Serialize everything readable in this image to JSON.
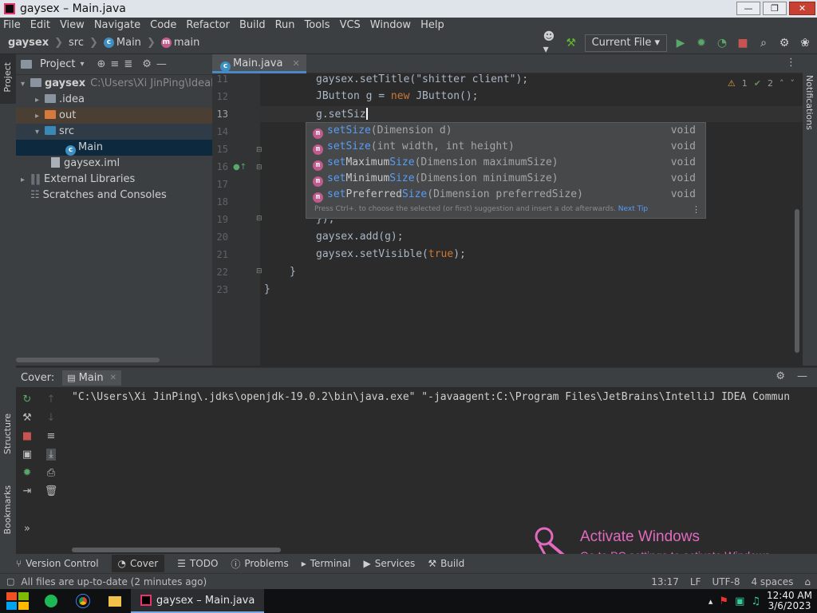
{
  "window": {
    "title": "gaysex – Main.java"
  },
  "menu": [
    "File",
    "Edit",
    "View",
    "Navigate",
    "Code",
    "Refactor",
    "Build",
    "Run",
    "Tools",
    "VCS",
    "Window",
    "Help"
  ],
  "breadcrumb": {
    "project": "gaysex",
    "folder": "src",
    "class": "Main",
    "method": "main"
  },
  "toolbar": {
    "run_config": "Current File"
  },
  "project_panel": {
    "title": "Project",
    "tree": [
      {
        "label": "gaysex",
        "hint": "C:\\Users\\Xi JinPing\\IdeaP"
      },
      {
        "label": ".idea"
      },
      {
        "label": "out"
      },
      {
        "label": "src"
      },
      {
        "label": "Main"
      },
      {
        "label": "gaysex.iml"
      },
      {
        "label": "External Libraries"
      },
      {
        "label": "Scratches and Consoles"
      }
    ]
  },
  "editor": {
    "tab": "Main.java",
    "inspection": {
      "warnings": "1",
      "weak": "2"
    },
    "lines": [
      "11",
      "12",
      "13",
      "14",
      "15",
      "16",
      "17",
      "18",
      "19",
      "20",
      "21",
      "22",
      "23"
    ],
    "code": {
      "l11": "gaysex.setTitle(\"shitter client\");",
      "l12_a": "JButton g = ",
      "l12_kw": "new",
      "l12_b": " JButton();",
      "l13": "g.setSiz",
      "l19": "});",
      "l20": "gaysex.add(g);",
      "l21_a": "gaysex.setVisible(",
      "l21_kw": "true",
      "l21_b": ");",
      "l22": "}",
      "l23": "}"
    }
  },
  "completion": {
    "items": [
      {
        "prefix": "setSize",
        "rest": "",
        "params": "(Dimension d)",
        "ret": "void"
      },
      {
        "prefix": "setSize",
        "rest": "",
        "params": "(int width, int height)",
        "ret": "void"
      },
      {
        "prefix": "set",
        "mid": "Maximum",
        "rest": "Size",
        "params": "(Dimension maximumSize)",
        "ret": "void"
      },
      {
        "prefix": "set",
        "mid": "Minimum",
        "rest": "Size",
        "params": "(Dimension minimumSize)",
        "ret": "void"
      },
      {
        "prefix": "set",
        "mid": "Preferred",
        "rest": "Size",
        "params": "(Dimension preferredSize)",
        "ret": "void"
      }
    ],
    "hint": "Press Ctrl+. to choose the selected (or first) suggestion and insert a dot afterwards.",
    "hint_link": "Next Tip"
  },
  "run_panel": {
    "label": "Cover:",
    "tab": "Main",
    "console_line": "\"C:\\Users\\Xi JinPing\\.jdks\\openjdk-19.0.2\\bin\\java.exe\" \"-javaagent:C:\\Program Files\\JetBrains\\IntelliJ IDEA Commun"
  },
  "side_labels": {
    "project": "Project",
    "structure": "Structure",
    "bookmarks": "Bookmarks",
    "notifications": "Notifications"
  },
  "bottom_tabs": [
    "Version Control",
    "Cover",
    "TODO",
    "Problems",
    "Terminal",
    "Services",
    "Build"
  ],
  "status": {
    "message": "All files are up-to-date (2 minutes ago)",
    "position": "13:17",
    "line_sep": "LF",
    "encoding": "UTF-8",
    "indent": "4 spaces"
  },
  "watermark": {
    "title": "Activate Windows",
    "subtitle": "Go to PC settings to activate Windows."
  },
  "taskbar": {
    "active_app": "gaysex – Main.java",
    "time": "12:40 AM",
    "date": "3/6/2023"
  }
}
